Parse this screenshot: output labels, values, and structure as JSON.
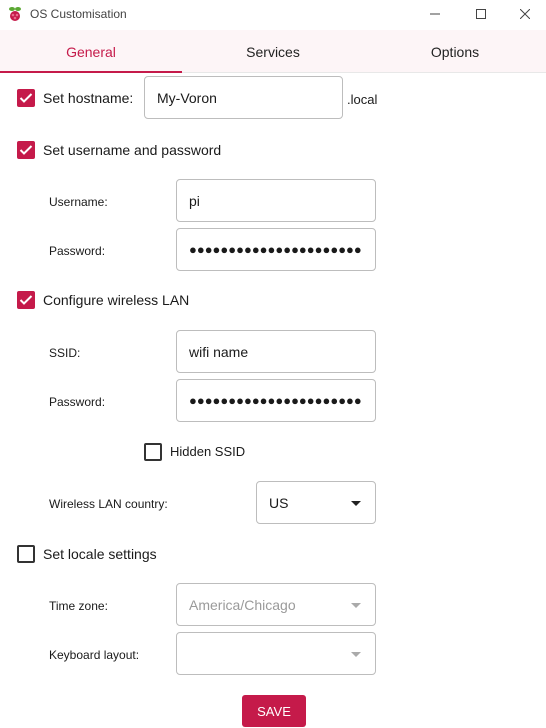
{
  "window": {
    "title": "OS Customisation",
    "icon": "raspberry-pi-icon"
  },
  "tabs": [
    {
      "label": "General",
      "active": true
    },
    {
      "label": "Services",
      "active": false
    },
    {
      "label": "Options",
      "active": false
    }
  ],
  "hostname": {
    "checkbox_label": "Set hostname:",
    "checked": true,
    "value": "My-Voron",
    "suffix": ".local"
  },
  "user": {
    "checkbox_label": "Set username and password",
    "checked": true,
    "username_label": "Username:",
    "username_value": "pi",
    "password_label": "Password:",
    "password_value": "●●●●●●●●●●●●●●●●●●●●●●"
  },
  "wlan": {
    "checkbox_label": "Configure wireless LAN",
    "checked": true,
    "ssid_label": "SSID:",
    "ssid_value": "wifi name",
    "password_label": "Password:",
    "password_value": "●●●●●●●●●●●●●●●●●●●●●●",
    "hidden_label": "Hidden SSID",
    "hidden_checked": false,
    "country_label": "Wireless LAN country:",
    "country_value": "US"
  },
  "locale": {
    "checkbox_label": "Set locale settings",
    "checked": false,
    "timezone_label": "Time zone:",
    "timezone_value": "America/Chicago",
    "keyboard_label": "Keyboard layout:",
    "keyboard_value": ""
  },
  "save_label": "SAVE",
  "colors": {
    "accent": "#c51a4a",
    "tab_bg": "#fdf5f7",
    "disabled_text": "#9a9a9a"
  }
}
